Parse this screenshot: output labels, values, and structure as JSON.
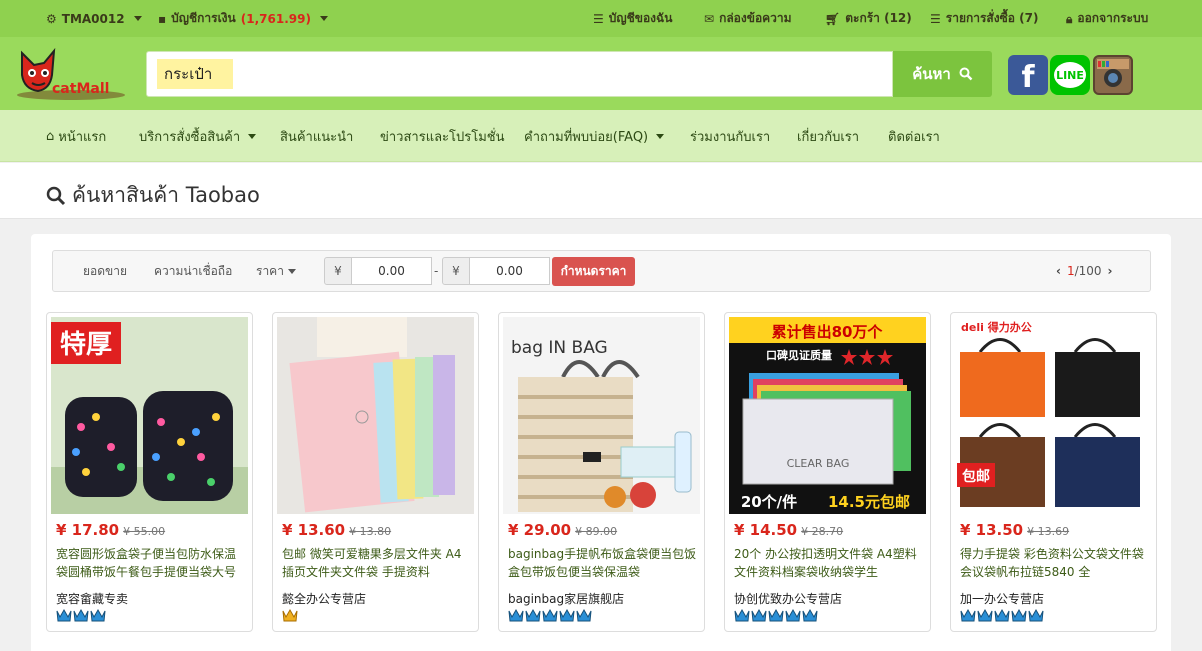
{
  "topbar": {
    "account_id": "TMA0012",
    "wallet_label": "บัญชีการเงิน",
    "wallet_amount": "(1,761.99)",
    "my_account": "บัญชีของฉัน",
    "inbox": "กล่องข้อความ",
    "cart": "ตะกร้า (12)",
    "orders": "รายการสั่งซื้อ (7)",
    "logout": "ออกจากระบบ"
  },
  "header": {
    "logo_text": "catMall",
    "search_value": "กระเป๋า",
    "search_button": "ค้นหา",
    "social": [
      "facebook-icon",
      "line-icon",
      "instagram-icon"
    ],
    "line_label": "LINE"
  },
  "nav": {
    "items": [
      {
        "label": "หน้าแรก"
      },
      {
        "label": "บริการสั่งซื้อสินค้า"
      },
      {
        "label": "สินค้าแนะนำ"
      },
      {
        "label": "ข่าวสารและโปรโมชั่น"
      },
      {
        "label": "คำถามที่พบบ่อย(FAQ)"
      },
      {
        "label": "ร่วมงานกับเรา"
      },
      {
        "label": "เกี่ยวกับเรา"
      },
      {
        "label": "ติดต่อเรา"
      }
    ]
  },
  "page": {
    "title": "ค้นหาสินค้า Taobao"
  },
  "filters": {
    "sort_sales": "ยอดขาย",
    "sort_trust": "ความน่าเชื่อถือ",
    "sort_price": "ราคา",
    "yen": "¥",
    "price_min": "0.00",
    "price_max": "0.00",
    "dash": "-",
    "set_price": "กำหนดราคา",
    "page_current": "1",
    "page_total": "/100"
  },
  "products": [
    {
      "price": "¥ 17.80",
      "old_price": "¥ 55.00",
      "title": "宽容圆形饭盒袋子便当包防水保温袋圆桶带饭午餐包手提便当袋大号",
      "shop": "宽容畲藏专卖",
      "rating": 3,
      "badge": "特厚"
    },
    {
      "price": "¥ 13.60",
      "old_price": "¥ 13.80",
      "title": "包邮 微笑可爱糖果多层文件夹 A4插页文件夹文件袋 手提资料",
      "shop": "懿全办公专营店",
      "rating": 1
    },
    {
      "price": "¥ 29.00",
      "old_price": "¥ 89.00",
      "title": "baginbag手提帆布饭盒袋便当包饭盒包带饭包便当袋保温袋",
      "shop": "baginbag家居旗舰店",
      "rating": 5,
      "brand": "bag IN BAG"
    },
    {
      "price": "¥ 14.50",
      "old_price": "¥ 28.70",
      "title": "20个 办公按扣透明文件袋 A4塑料文件资料档案袋收纳袋学生",
      "shop": "协创优致办公专营店",
      "rating": 5,
      "banner": "累计售出80万个",
      "banner2": "口碑见证质量",
      "bag_label": "CLEAR BAG",
      "promo_left": "20个/件",
      "promo_right": "14.5元包邮"
    },
    {
      "price": "¥ 13.50",
      "old_price": "¥ 13.69",
      "title": "得力手提袋 彩色资料公文袋文件袋会议袋帆布拉链5840 全",
      "shop": "加一办公专营店",
      "rating": 5,
      "brand": "deli 得力办公",
      "badge": "包邮"
    }
  ],
  "colors": {
    "topbar": "#8fd14f",
    "header": "#9ada5c",
    "nav": "#d7f0b9",
    "price_red": "#d9261c",
    "button_red": "#d9534f"
  }
}
